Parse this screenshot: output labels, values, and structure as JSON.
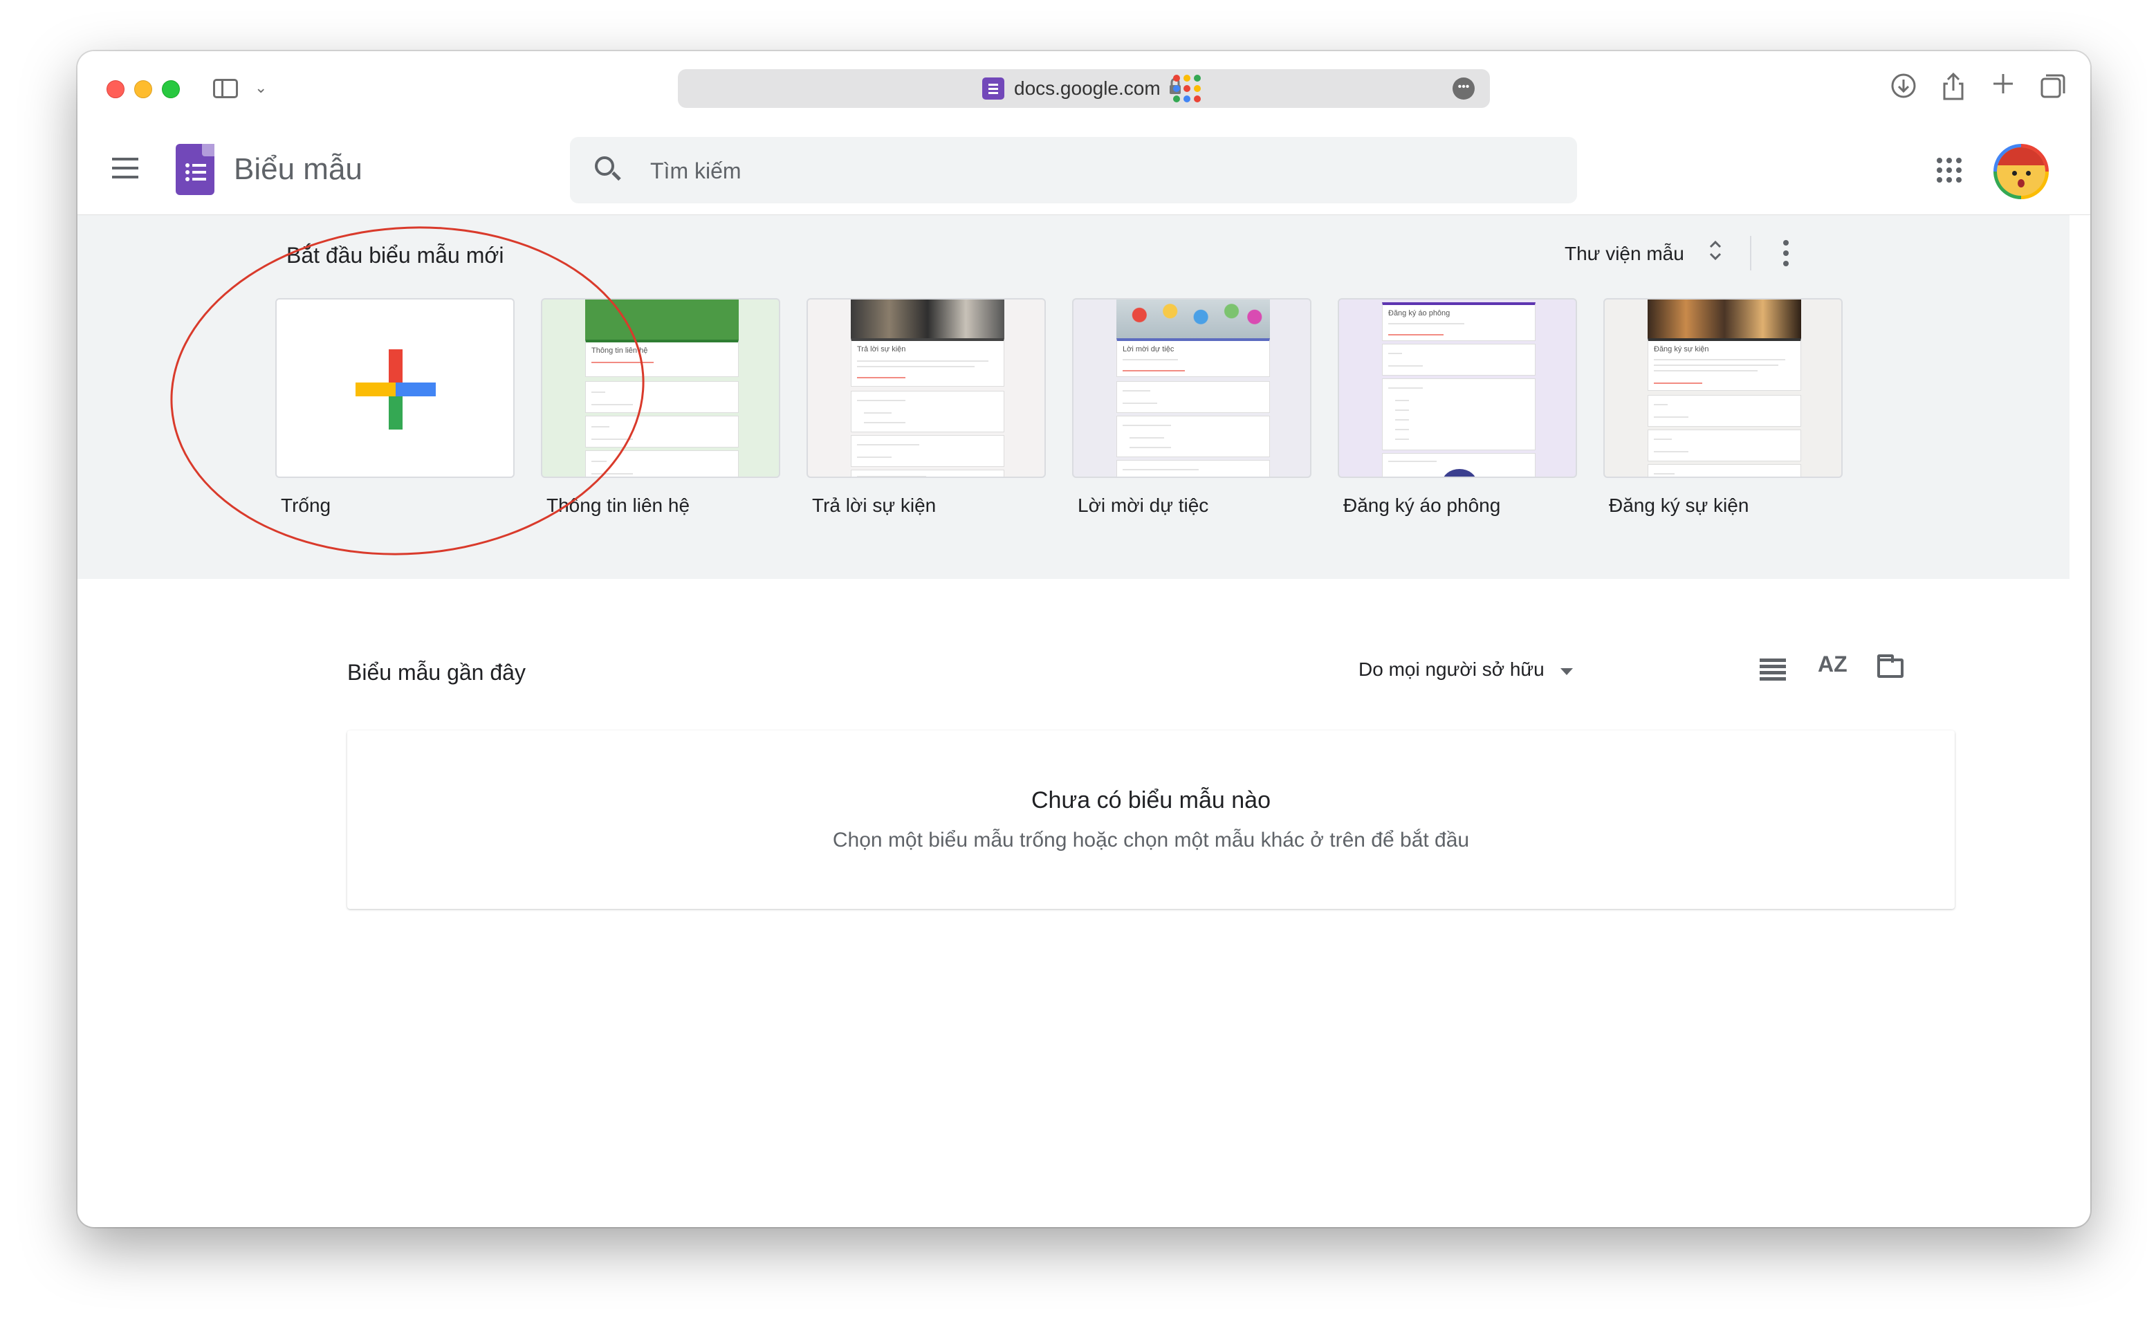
{
  "browser": {
    "url": "docs.google.com"
  },
  "header": {
    "app_title": "Biểu mẫu",
    "search_placeholder": "Tìm kiếm"
  },
  "templates": {
    "section_title": "Bắt đầu biểu mẫu mới",
    "gallery_label": "Thư viện mẫu",
    "items": [
      {
        "label": "Trống"
      },
      {
        "label": "Thông tin liên hệ"
      },
      {
        "label": "Trả lời sự kiện"
      },
      {
        "label": "Lời mời dự tiệc"
      },
      {
        "label": "Đăng ký áo phông"
      },
      {
        "label": "Đăng ký sự kiện"
      }
    ],
    "previews": {
      "contact_heading": "Thông tin liên hệ",
      "rsvp_heading": "Trả lời sự kiện",
      "party_heading": "Lời mời dự tiệc",
      "tshirt_heading": "Đăng ký áo phông",
      "event_heading": "Đăng ký sự kiện"
    }
  },
  "recent": {
    "title": "Biểu mẫu gần đây",
    "owner_filter": "Do mọi người sở hữu",
    "sort_icon_label": "AZ",
    "empty_title": "Chưa có biểu mẫu nào",
    "empty_subtitle": "Chọn một biểu mẫu trống hoặc chọn một mẫu khác ở trên để bắt đầu"
  },
  "icons": {
    "toolbar": [
      "sidebar-icon",
      "chevron-down-icon",
      "lock-icon",
      "more-icon",
      "download-icon",
      "google-apps-icon",
      "share-icon",
      "plus-icon",
      "tabs-icon"
    ],
    "header": [
      "menu-icon",
      "forms-logo-icon",
      "search-icon",
      "apps-grid-icon",
      "avatar"
    ],
    "recent": [
      "list-view-icon",
      "sort-az-icon",
      "folder-icon"
    ]
  },
  "colors": {
    "forms_purple": "#7248b9",
    "google_red": "#ea4335",
    "google_yellow": "#fbbc05",
    "google_green": "#34a853",
    "google_blue": "#4285f4",
    "section_bg": "#f1f3f4",
    "annotation_red": "#d93a2b"
  }
}
